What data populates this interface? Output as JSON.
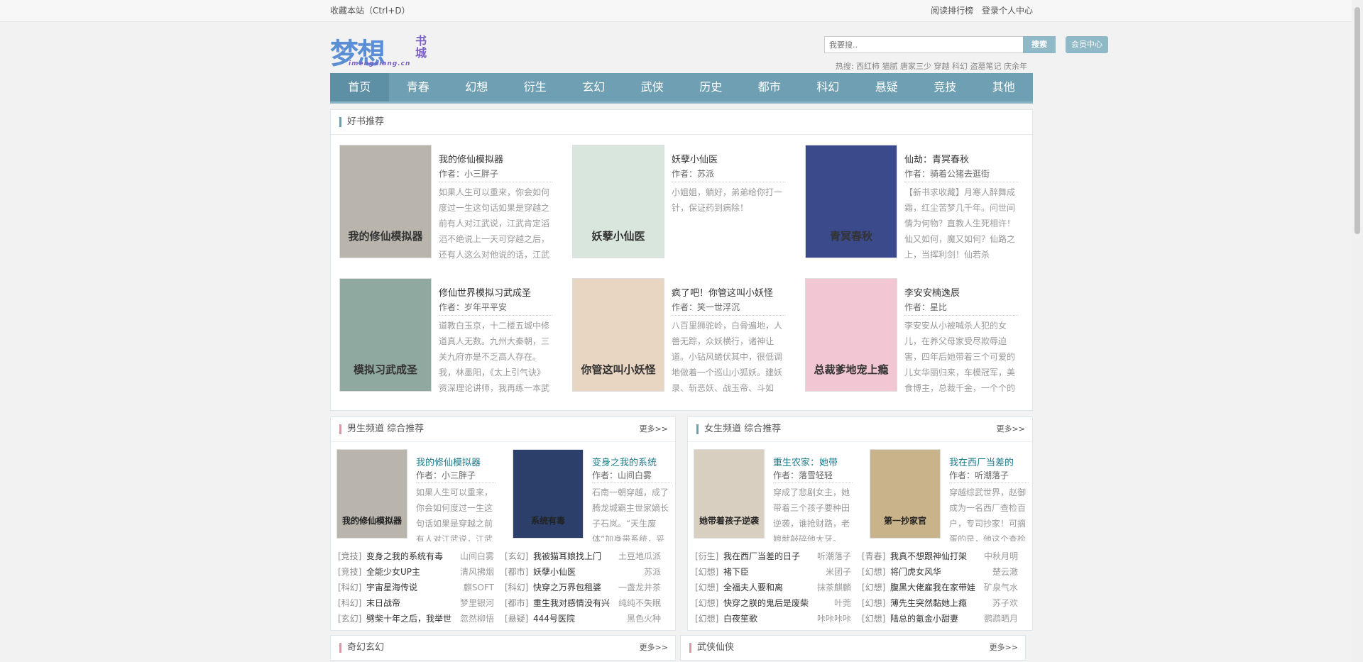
{
  "topbar": {
    "bookmark": "收藏本站（Ctrl+D）",
    "links": [
      "阅读排行榜",
      "登录个人中心"
    ]
  },
  "logo": {
    "main": "梦想",
    "side": "书城",
    "sub": "imengxiang.cn"
  },
  "search": {
    "placeholder": "我要搜..",
    "button": "搜索",
    "vip": "会员中心"
  },
  "hot": {
    "label": "热搜:",
    "items": [
      "西红柿",
      "猫腻",
      "唐家三少",
      "穿越",
      "科幻",
      "盗墓笔记",
      "庆余年"
    ]
  },
  "nav": [
    "首页",
    "青春",
    "幻想",
    "衍生",
    "玄幻",
    "武侠",
    "历史",
    "都市",
    "科幻",
    "悬疑",
    "竞技",
    "其他"
  ],
  "recommend": {
    "title": "好书推荐",
    "books": [
      {
        "title": "我的修仙模拟器",
        "author": "作者：小三胖子",
        "desc": "如果人生可以重来，你会如何度过一生这句话如果是穿越之前有人对江武说，江武肯定滔滔不绝说上一天可穿越之后，还有人这么对他说的话，江武",
        "cover": "#b9b5ad",
        "cover_text": "我的修仙模拟器"
      },
      {
        "title": "妖孽小仙医",
        "author": "作者：苏派",
        "desc": "小姐姐，躺好，弟弟给你打一针，保证药到病除！",
        "cover": "#d9e6dd",
        "cover_text": "妖孽小仙医"
      },
      {
        "title": "仙劫：青冥春秋",
        "author": "作者：骑着公猪去逛街",
        "desc": "【新书求收藏】月寒人醉舞成霜，红尘苦梦几千年。问世间情为何物？直教人生死相许！仙又如何，魔又如何？仙路之上，当挥利剑！仙若杀",
        "cover": "#3a4a8a",
        "cover_text": "青冥春秋"
      },
      {
        "title": "修仙世界模拟习武成圣",
        "author": "作者：岁年平平安",
        "desc": "道教白玉京，十二楼五城中修道真人无数。九州大秦朝，三关九府亦是不乏高人存在。我，林墨阳，《太上引气诀》资深理论讲师，我再练一本武",
        "cover": "#8fa8a0",
        "cover_text": "模拟习武成圣"
      },
      {
        "title": "疯了吧！你管这叫小妖怪",
        "author": "作者：笑一世浮沉",
        "desc": "八百里狮驼岭，白骨遍地，人兽无踪，众妖横行，诸神让道。小钻风蜷伏其中，很低调地做着一个巡山小狐妖。建妖录、斩恶妖、战玉帝、斗如",
        "cover": "#e9d6c2",
        "cover_text": "你管这叫小妖怪"
      },
      {
        "title": "李安安楠逸辰",
        "author": "作者：星比",
        "desc": "李安安从小被喊杀人犯的女儿，在养父母家受尽欺辱迫害，四年后她带着三个可爱的儿女华丽归来，车模冠军，美食博主，总裁千金，一个个的",
        "cover": "#f2c6d3",
        "cover_text": "总裁爹地宠上瘾"
      }
    ]
  },
  "male": {
    "title": "男生频道 综合推荐",
    "more": "更多>>",
    "featured": [
      {
        "title": "我的修仙模拟器",
        "author": "作者：小三胖子",
        "desc": "如果人生可以重来，你会如何度过一生这句话如果是穿越之前有人对江武说，江武",
        "cover": "#b9b5ad",
        "cover_text": "我的修仙模拟器"
      },
      {
        "title": "变身之我的系统",
        "author": "作者：山间白雾",
        "desc": "石南一朝穿越，成了腾龙城霸主世家嫡长子石岚。“天生废体”加身带系统，妥",
        "cover": "#2b3f6a",
        "cover_text": "系统有毒"
      }
    ],
    "rows": [
      [
        [
          "[竞技]",
          "变身之我的系统有毒",
          "山间白雾"
        ],
        [
          "[玄幻]",
          "我被猫耳娘找上门",
          "土豆地瓜派"
        ]
      ],
      [
        [
          "[竞技]",
          "全能少女UP主",
          "清风拂烟"
        ],
        [
          "[都市]",
          "妖孽小仙医",
          "苏派"
        ]
      ],
      [
        [
          "[科幻]",
          "宇宙星海传说",
          "麒SOFT"
        ],
        [
          "[科幻]",
          "快穿之万界包租婆",
          "一盏龙井茶"
        ]
      ],
      [
        [
          "[科幻]",
          "末日战帝",
          "梦里银河"
        ],
        [
          "[都市]",
          "重生我对感情没有兴",
          "纯纯不失眠"
        ]
      ],
      [
        [
          "[玄幻]",
          "劈柴十年之后，我举世",
          "忽然柳悟"
        ],
        [
          "[悬疑]",
          "444号医院",
          "黑色火种"
        ]
      ]
    ]
  },
  "female": {
    "title": "女生频道 综合推荐",
    "more": "更多>>",
    "featured": [
      {
        "title": "重生农家：她带",
        "author": "作者：落雪轻轻",
        "desc": "穿成了悲剧女主，她带着三个孩子要种田逆袭，谁抢财路，老娘就敲碎他大牙。",
        "cover": "#d8cfc0",
        "cover_text": "她带着孩子逆袭"
      },
      {
        "title": "我在西厂当差的",
        "author": "作者：听潮落子",
        "desc": "穿越综武世界，赵御成为一名西厂查检百户，专司抄家！可摘蛋的是，他这个查检",
        "cover": "#c9b38a",
        "cover_text": "第一抄家官"
      }
    ],
    "rows": [
      [
        [
          "[衍生]",
          "我在西厂当差的日子",
          "听潮落子"
        ],
        [
          "[青春]",
          "我真不想跟神仙打架",
          "中秋月明"
        ]
      ],
      [
        [
          "[幻想]",
          "褚下臣",
          "米团子"
        ],
        [
          "[幻想]",
          "将门虎女风华",
          "楚云澈"
        ]
      ],
      [
        [
          "[幻想]",
          "全福夫人要和离",
          "抹茶麒麟"
        ],
        [
          "[幻想]",
          "腹黑大佬雇我在家带娃",
          "矿泉气水"
        ]
      ],
      [
        [
          "[幻想]",
          "快穿之朕的鬼后是废柴",
          "叶莞"
        ],
        [
          "[幻想]",
          "薄先生突然黏她上瘾",
          "苏子欢"
        ]
      ],
      [
        [
          "[幻想]",
          "白夜笙歌",
          "咔咔咔咔"
        ],
        [
          "[幻想]",
          "陆总的氪金小甜妻",
          "鹦鹉晒月"
        ]
      ]
    ]
  },
  "bottom": [
    {
      "title": "奇幻玄幻",
      "more": "更多>>"
    },
    {
      "title": "武侠仙侠",
      "more": "更多>>"
    }
  ]
}
